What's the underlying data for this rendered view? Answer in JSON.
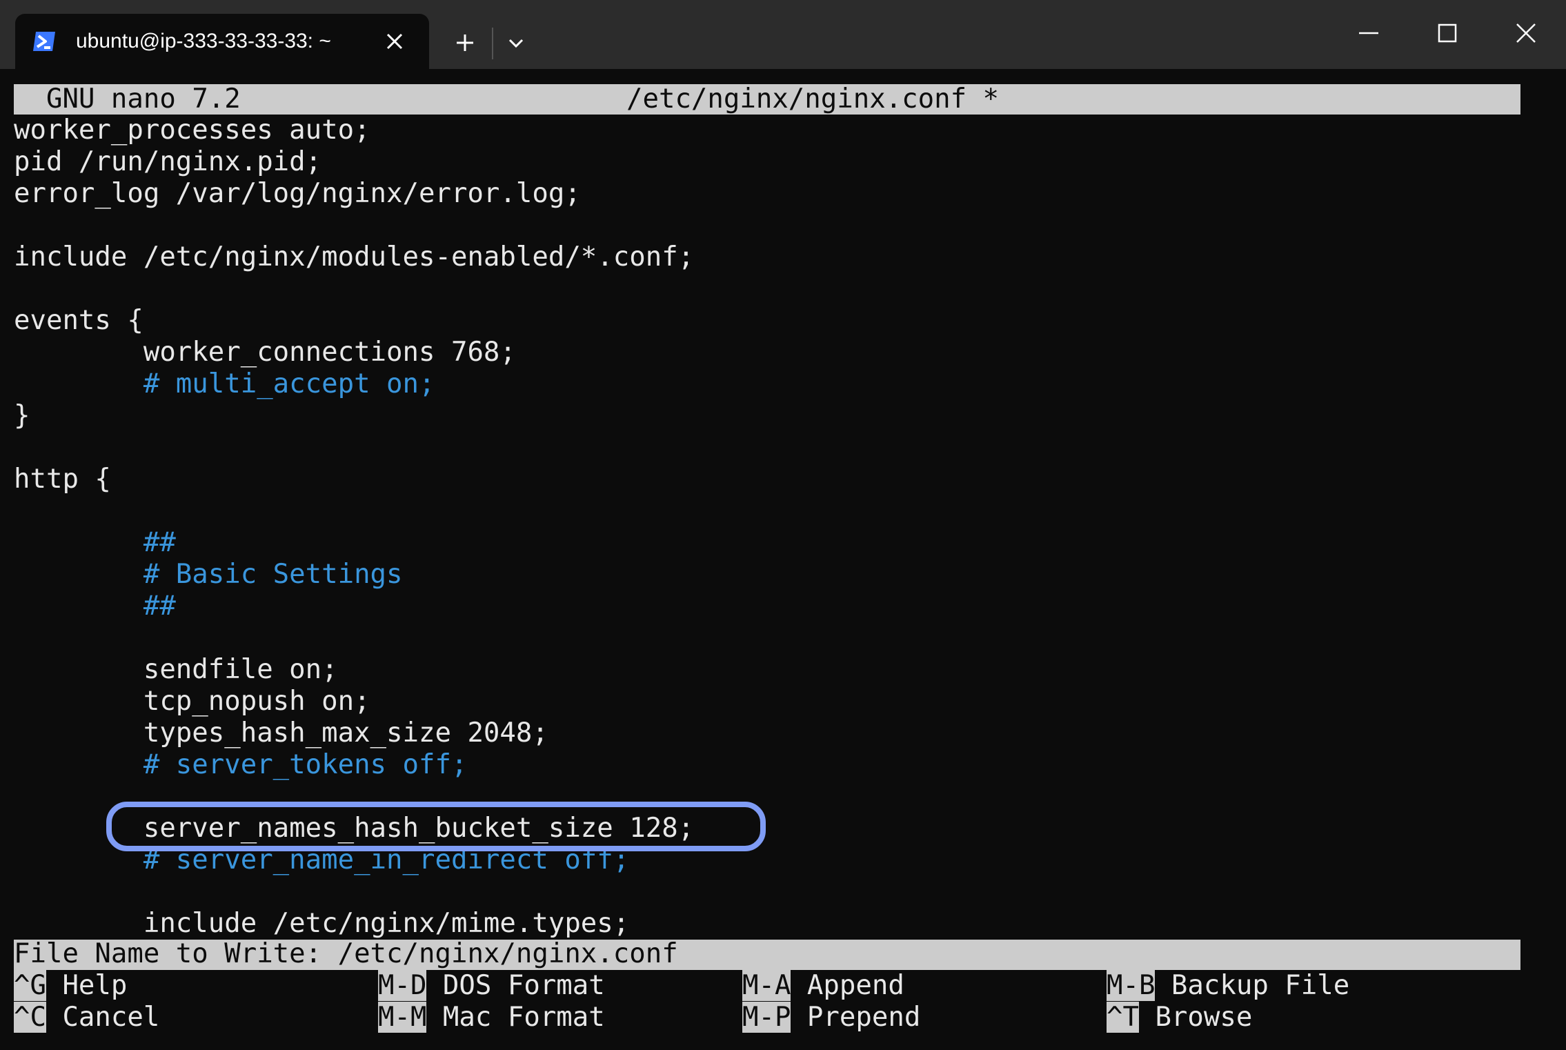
{
  "window": {
    "tab_title": "ubuntu@ip-333-33-33-33: ~",
    "icons": {
      "tab": "powershell-terminal-icon",
      "close_tab": "close-icon",
      "new_tab": "plus-icon",
      "dropdown": "chevron-down-icon",
      "minimize": "minimize-icon",
      "maximize": "maximize-icon",
      "close": "close-icon"
    }
  },
  "nano": {
    "version": "GNU nano 7.2",
    "filename": "/etc/nginx/nginx.conf *",
    "lines": [
      {
        "text": "worker_processes auto;",
        "comment": false
      },
      {
        "text": "pid /run/nginx.pid;",
        "comment": false
      },
      {
        "text": "error_log /var/log/nginx/error.log;",
        "comment": false
      },
      {
        "text": "",
        "comment": false
      },
      {
        "text": "include /etc/nginx/modules-enabled/*.conf;",
        "comment": false
      },
      {
        "text": "",
        "comment": false
      },
      {
        "text": "events {",
        "comment": false
      },
      {
        "text": "        worker_connections 768;",
        "comment": false
      },
      {
        "text": "        # multi_accept on;",
        "comment": true
      },
      {
        "text": "}",
        "comment": false
      },
      {
        "text": "",
        "comment": false
      },
      {
        "text": "http {",
        "comment": false
      },
      {
        "text": "",
        "comment": false
      },
      {
        "text": "        ##",
        "comment": true
      },
      {
        "text": "        # Basic Settings",
        "comment": true
      },
      {
        "text": "        ##",
        "comment": true
      },
      {
        "text": "",
        "comment": false
      },
      {
        "text": "        sendfile on;",
        "comment": false
      },
      {
        "text": "        tcp_nopush on;",
        "comment": false
      },
      {
        "text": "        types_hash_max_size 2048;",
        "comment": false
      },
      {
        "text": "        # server_tokens off;",
        "comment": true
      },
      {
        "text": "",
        "comment": false
      },
      {
        "text": "        server_names_hash_bucket_size 128;",
        "comment": false
      },
      {
        "text": "        # server_name_in_redirect off;",
        "comment": true
      },
      {
        "text": "",
        "comment": false
      },
      {
        "text": "        include /etc/nginx/mime.types;",
        "comment": false
      }
    ],
    "prompt": "File Name to Write: /etc/nginx/nginx.conf",
    "shortcuts": [
      {
        "key": "^G",
        "label": "Help"
      },
      {
        "key": "^C",
        "label": "Cancel"
      },
      {
        "key": "M-D",
        "label": "DOS Format"
      },
      {
        "key": "M-M",
        "label": "Mac Format"
      },
      {
        "key": "M-A",
        "label": "Append"
      },
      {
        "key": "M-P",
        "label": "Prepend"
      },
      {
        "key": "M-B",
        "label": "Backup File"
      },
      {
        "key": "^T",
        "label": "Browse"
      }
    ],
    "highlight_color": "#7f9cf5",
    "comment_color": "#3a96dd"
  }
}
